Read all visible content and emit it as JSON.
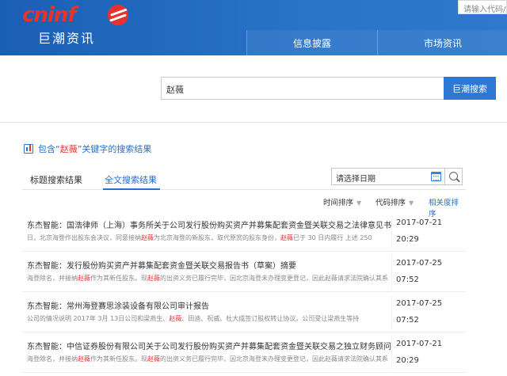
{
  "logo": {
    "brand": "cninf",
    "subtitle": "巨潮资讯"
  },
  "top_search": {
    "placeholder": "请输入代码/"
  },
  "nav": {
    "items": [
      "信息披露",
      "市场资讯"
    ]
  },
  "search": {
    "value": "赵薇",
    "button": "巨潮搜索"
  },
  "results_header": {
    "prefix": "包含“",
    "keyword": "赵薇",
    "suffix": "”关键字的搜索结果"
  },
  "tabs": [
    "标题搜索结果",
    "全文搜索结果"
  ],
  "active_tab": "全文搜索结果",
  "date_filter": {
    "placeholder": "请选择日期"
  },
  "sorts": {
    "time": "时间排序",
    "code": "代码排序",
    "relevance": "相关度排序"
  },
  "results": [
    {
      "title": "东杰智能：国浩律师（上海）事务所关于公司发行股份购买资产并募集配套资金暨关联交易之法律意见书",
      "snippet_pre": "日，北京海登作出股东会决议，同意接纳",
      "snippet_kw1": "赵薇",
      "snippet_mid": "为北京海登的新股东，取代原赏的股东身份，",
      "snippet_kw2": "赵薇",
      "snippet_post": "已于 30 日内履行 上述 250",
      "date": "2017-07-21",
      "time": "20:29"
    },
    {
      "title": "东杰智能：发行股份购买资产并募集配套资金暨关联交易报告书（草案）摘要",
      "snippet_pre": "海登除名，并接纳",
      "snippet_kw1": "赵薇",
      "snippet_mid": "作为其新任股东。现",
      "snippet_kw2": "赵薇",
      "snippet_post": "的出资义务已履行完毕，因北京海登未办理变更登记，因此赵薇请求法院确认其系",
      "date": "2017-07-25",
      "time": "07:52"
    },
    {
      "title": "东杰智能：常州海登赛思涂装设备有限公司审计报告",
      "snippet_pre": "公司的情况说明 2017年 3月 13日公司和梁燕生、",
      "snippet_kw1": "赵薇",
      "snippet_mid": "、田迪、祝威、杜大成签订股权转让协议，公司受让",
      "snippet_kw2": "",
      "snippet_post": "梁燕生等持",
      "date": "2017-07-25",
      "time": "07:52"
    },
    {
      "title": "东杰智能：中信证券股份有限公司关于公司发行股份购买资产并募集配套资金暨关联交易之独立财务顾问报告",
      "snippet_pre": "海登除名，并接纳",
      "snippet_kw1": "赵薇",
      "snippet_mid": "作为其新任股东。现",
      "snippet_kw2": "赵薇",
      "snippet_post": "的出资义务已履行完毕，因北京海登未办理变更登记，因此赵薇请求法院确认其系",
      "date": "2017-07-21",
      "time": "20:29"
    }
  ],
  "colors": {
    "header_blue": "#1a5fb5",
    "accent_blue": "#2a6fc9",
    "keyword_red": "#e8322b",
    "logo_red": "#e8322b"
  }
}
